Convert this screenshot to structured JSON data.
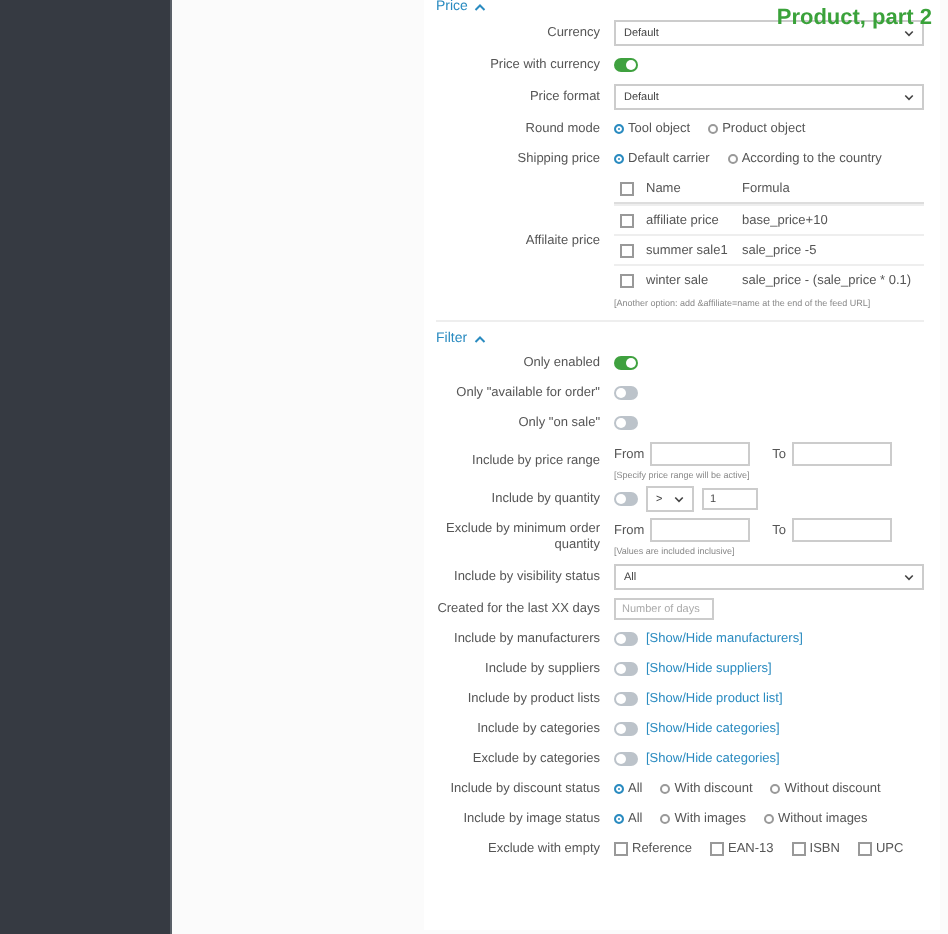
{
  "title": "Product, part 2",
  "sections": [
    {
      "heading": "Price",
      "expanded": true,
      "rows": [
        {
          "kind": "select",
          "label": "Currency",
          "value": "Default"
        },
        {
          "kind": "toggle",
          "label": "Price with currency",
          "on": true
        },
        {
          "kind": "select",
          "label": "Price format",
          "value": "Default"
        },
        {
          "kind": "radio",
          "label": "Round mode",
          "options": [
            {
              "label": "Tool object",
              "selected": true
            },
            {
              "label": "Product object",
              "selected": false
            }
          ]
        },
        {
          "kind": "radio",
          "label": "Shipping price",
          "options": [
            {
              "label": "Default carrier",
              "selected": true
            },
            {
              "label": "According to the country",
              "selected": false
            }
          ]
        },
        {
          "kind": "table",
          "label": "Affilaite price",
          "columns": [
            "Name",
            "Formula"
          ],
          "header_checked": false,
          "rows": [
            {
              "name": "affiliate price",
              "formula": "base_price+10",
              "checked": false
            },
            {
              "name": "summer sale1",
              "formula": "sale_price -5",
              "checked": false
            },
            {
              "name": "winter sale",
              "formula": "sale_price - (sale_price * 0.1)",
              "checked": false
            }
          ],
          "note": "[Another option: add &affiliate=name at the end of the feed URL]"
        }
      ]
    },
    {
      "heading": "Filter",
      "expanded": true,
      "rows": [
        {
          "kind": "toggle",
          "label": "Only enabled",
          "on": true
        },
        {
          "kind": "toggle",
          "label": "Only \"available for order\"",
          "on": false
        },
        {
          "kind": "toggle",
          "label": "Only \"on sale\"",
          "on": false
        },
        {
          "kind": "range",
          "label": "Include by price range",
          "from_label": "From",
          "to_label": "To",
          "note": "[Specify price range will be active]"
        },
        {
          "kind": "quantity",
          "label": "Include by quantity",
          "on": false,
          "operator": ">",
          "value": "1"
        },
        {
          "kind": "range",
          "label": "Exclude by minimum order quantity",
          "from_label": "From",
          "to_label": "To",
          "note": "[Values are included inclusive]"
        },
        {
          "kind": "select",
          "label": "Include by visibility status",
          "value": "All"
        },
        {
          "kind": "input",
          "label": "Created for the last XX days",
          "placeholder": "Number of days"
        },
        {
          "kind": "toggle",
          "label": "Include by manufacturers",
          "on": false,
          "link": "[Show/Hide manufacturers]"
        },
        {
          "kind": "toggle",
          "label": "Include by suppliers",
          "on": false,
          "link": "[Show/Hide suppliers]"
        },
        {
          "kind": "toggle",
          "label": "Include by product lists",
          "on": false,
          "link": "[Show/Hide product list]"
        },
        {
          "kind": "toggle",
          "label": "Include by categories",
          "on": false,
          "link": "[Show/Hide categories]"
        },
        {
          "kind": "toggle",
          "label": "Exclude by categories",
          "on": false,
          "link": "[Show/Hide categories]"
        },
        {
          "kind": "radio",
          "label": "Include by discount status",
          "options": [
            {
              "label": "All",
              "selected": true
            },
            {
              "label": "With discount",
              "selected": false
            },
            {
              "label": "Without discount",
              "selected": false
            }
          ]
        },
        {
          "kind": "radio",
          "label": "Include by image status",
          "options": [
            {
              "label": "All",
              "selected": true
            },
            {
              "label": "With images",
              "selected": false
            },
            {
              "label": "Without images",
              "selected": false
            }
          ]
        },
        {
          "kind": "checkboxes",
          "label": "Exclude with empty",
          "options": [
            {
              "label": "Reference",
              "checked": false
            },
            {
              "label": "EAN-13",
              "checked": false
            },
            {
              "label": "ISBN",
              "checked": false
            },
            {
              "label": "UPC",
              "checked": false
            }
          ]
        }
      ]
    }
  ]
}
